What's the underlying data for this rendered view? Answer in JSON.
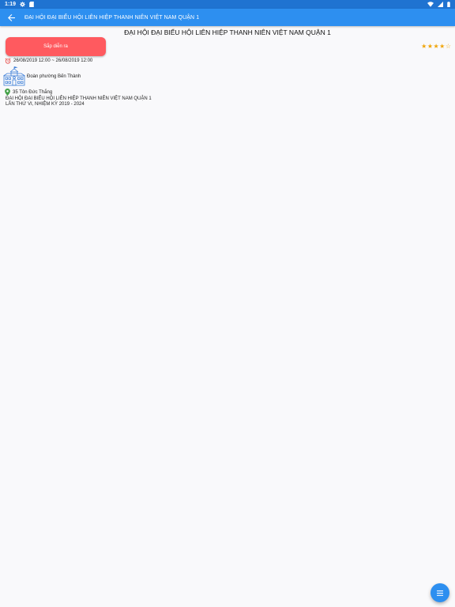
{
  "status_bar": {
    "time": "1:19",
    "left_icons": [
      "gear-icon",
      "sd-card-icon"
    ],
    "right_icons": [
      "wifi-icon",
      "signal-icon",
      "battery-icon"
    ]
  },
  "app_bar": {
    "title": "ĐẠI HỘI ĐẠI BIỂU HỘI LIÊN HIỆP THANH NIÊN VIỆT NAM QUẬN 1",
    "back_icon": "arrow-back-icon",
    "background": "#2d8ff0"
  },
  "event": {
    "title": "ĐẠI HỘI ĐẠI BIỂU HỘI LIÊN HIỆP THANH NIÊN VIỆT NAM QUẬN 1",
    "status_label": "Sắp diễn ra",
    "status_color": "#ff5a5f",
    "rating": 4,
    "rating_max": 5,
    "time_range": "26/08/2019 12:00 ~ 26/08/2019 12:00",
    "organizer": "Đoàn phường Bến Thành",
    "address": "35 Tôn Đức Thắng",
    "description_lines": [
      "ĐẠI HỘI ĐẠI BIỂU HỘI LIÊN HIỆP THANH NIÊN VIỆT NAM QUẬN 1",
      "LẦN THỨ VI, NHIỆM KỲ 2019 - 2024"
    ]
  },
  "fab": {
    "icon": "menu-icon"
  }
}
